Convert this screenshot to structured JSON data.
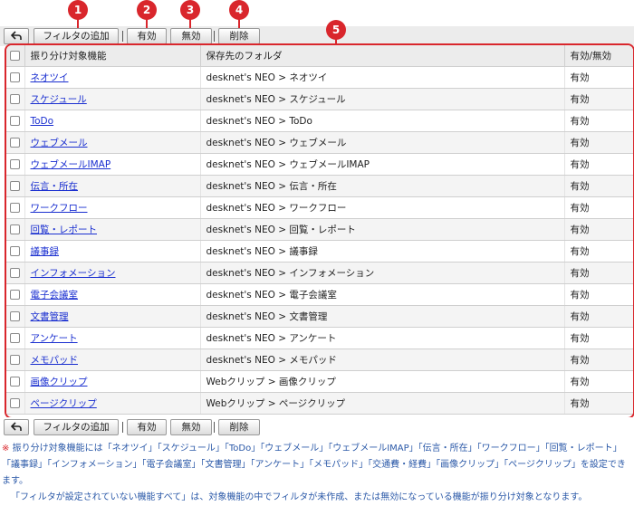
{
  "callouts": [
    "1",
    "2",
    "3",
    "4",
    "5"
  ],
  "toolbar": {
    "back_icon": "back-arrow-icon",
    "add_filter": "フィルタの追加",
    "enable": "有効",
    "disable": "無効",
    "delete": "削除"
  },
  "table": {
    "headers": {
      "function": "振り分け対象機能",
      "folder": "保存先のフォルダ",
      "status": "有効/無効"
    },
    "rows": [
      {
        "function": "ネオツイ",
        "folder": "desknet's NEO > ネオツイ",
        "status": "有効"
      },
      {
        "function": "スケジュール",
        "folder": "desknet's NEO > スケジュール",
        "status": "有効"
      },
      {
        "function": "ToDo",
        "folder": "desknet's NEO > ToDo",
        "status": "有効"
      },
      {
        "function": "ウェブメール",
        "folder": "desknet's NEO > ウェブメール",
        "status": "有効"
      },
      {
        "function": "ウェブメールIMAP",
        "folder": "desknet's NEO > ウェブメールIMAP",
        "status": "有効"
      },
      {
        "function": "伝言・所在",
        "folder": "desknet's NEO > 伝言・所在",
        "status": "有効"
      },
      {
        "function": "ワークフロー",
        "folder": "desknet's NEO > ワークフロー",
        "status": "有効"
      },
      {
        "function": "回覧・レポート",
        "folder": "desknet's NEO > 回覧・レポート",
        "status": "有効"
      },
      {
        "function": "議事録",
        "folder": "desknet's NEO > 議事録",
        "status": "有効"
      },
      {
        "function": "インフォメーション",
        "folder": "desknet's NEO > インフォメーション",
        "status": "有効"
      },
      {
        "function": "電子会議室",
        "folder": "desknet's NEO > 電子会議室",
        "status": "有効"
      },
      {
        "function": "文書管理",
        "folder": "desknet's NEO > 文書管理",
        "status": "有効"
      },
      {
        "function": "アンケート",
        "folder": "desknet's NEO > アンケート",
        "status": "有効"
      },
      {
        "function": "メモパッド",
        "folder": "desknet's NEO > メモパッド",
        "status": "有効"
      },
      {
        "function": "画像クリップ",
        "folder": "Webクリップ > 画像クリップ",
        "status": "有効"
      },
      {
        "function": "ページクリップ",
        "folder": "Webクリップ > ページクリップ",
        "status": "有効"
      }
    ]
  },
  "note": {
    "mark": "※",
    "line1": "振り分け対象機能には「ネオツイ」「スケジュール」「ToDo」「ウェブメール」「ウェブメールIMAP」「伝言・所在」「ワークフロー」「回覧・レポート」「議事録」「インフォメーション」「電子会議室」「文書管理」「アンケート」「メモパッド」「交通費・経費」「画像クリップ」「ページクリップ」を設定できます。",
    "line2": "「フィルタが設定されていない機能すべて」は、対象機能の中でフィルタが未作成、または無効になっている機能が振り分け対象となります。"
  },
  "colors": {
    "accent": "#d9262c",
    "link": "#1a2fd0",
    "note": "#2b59a8"
  }
}
